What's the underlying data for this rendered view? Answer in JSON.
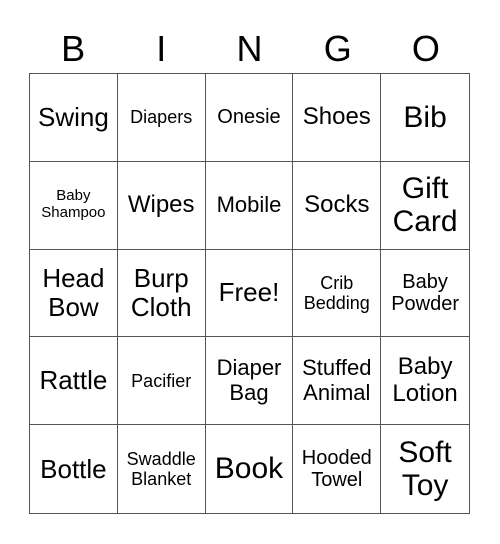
{
  "header": [
    "B",
    "I",
    "N",
    "G",
    "O"
  ],
  "cells": [
    "Swing",
    "Diapers",
    "Onesie",
    "Shoes",
    "Bib",
    "Baby Shampoo",
    "Wipes",
    "Mobile",
    "Socks",
    "Gift Card",
    "Head Bow",
    "Burp Cloth",
    "Free!",
    "Crib Bedding",
    "Baby Powder",
    "Rattle",
    "Pacifier",
    "Diaper Bag",
    "Stuffed Animal",
    "Baby Lotion",
    "Bottle",
    "Swaddle Blanket",
    "Book",
    "Hooded Towel",
    "Soft Toy"
  ]
}
